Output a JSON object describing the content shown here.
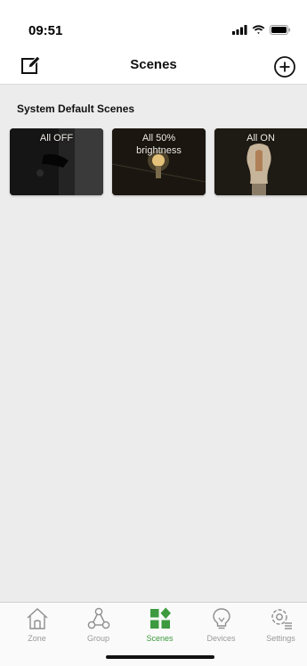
{
  "status_bar": {
    "time": "09:51"
  },
  "nav": {
    "title": "Scenes"
  },
  "section": {
    "title": "System Default Scenes"
  },
  "scenes": [
    {
      "label": "All OFF"
    },
    {
      "label": "All 50%\nbrightness"
    },
    {
      "label": "All ON"
    }
  ],
  "tabs": [
    {
      "label": "Zone",
      "icon": "home-icon",
      "active": false
    },
    {
      "label": "Group",
      "icon": "group-icon",
      "active": false
    },
    {
      "label": "Scenes",
      "icon": "scenes-icon",
      "active": true
    },
    {
      "label": "Devices",
      "icon": "bulb-icon",
      "active": false
    },
    {
      "label": "Settings",
      "icon": "settings-icon",
      "active": false
    }
  ],
  "colors": {
    "accent": "#3d9a3f",
    "inactive": "#9a9a9a",
    "background": "#ececec"
  }
}
